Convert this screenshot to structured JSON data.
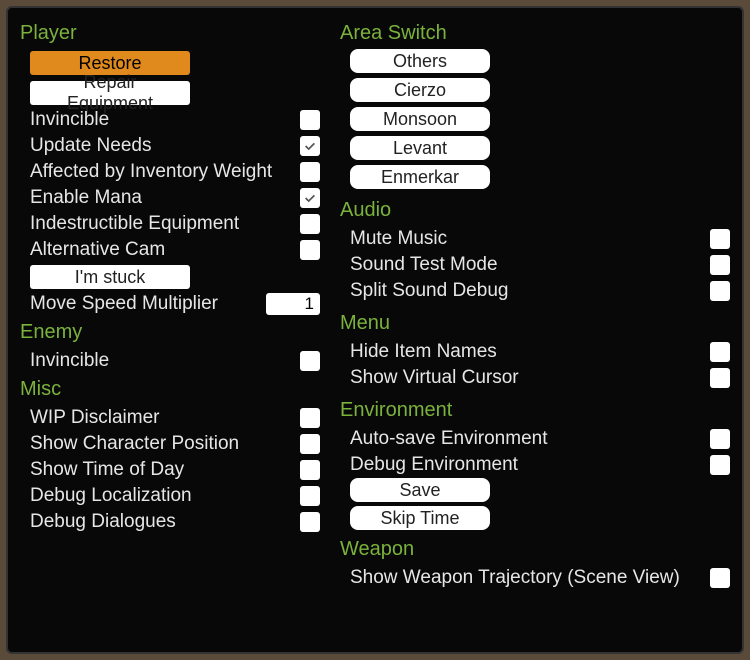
{
  "player": {
    "header": "Player",
    "restore": "Restore",
    "repair": "Repair Equipment",
    "invincible_label": "Invincible",
    "invincible": false,
    "update_needs_label": "Update Needs",
    "update_needs": true,
    "weight_label": "Affected by Inventory Weight",
    "weight": false,
    "mana_label": "Enable Mana",
    "mana": true,
    "indestructible_label": "Indestructible Equipment",
    "indestructible": false,
    "altcam_label": "Alternative Cam",
    "altcam": false,
    "stuck": "I'm stuck",
    "movespeed_label": "Move Speed Multiplier",
    "movespeed_value": "1"
  },
  "enemy": {
    "header": "Enemy",
    "invincible_label": "Invincible",
    "invincible": false
  },
  "misc": {
    "header": "Misc",
    "wip_label": "WIP Disclaimer",
    "wip": false,
    "charpos_label": "Show Character Position",
    "charpos": false,
    "tod_label": "Show Time of Day",
    "tod": false,
    "loc_label": "Debug Localization",
    "loc": false,
    "dlg_label": "Debug Dialogues",
    "dlg": false
  },
  "area": {
    "header": "Area Switch",
    "items": [
      "Others",
      "Cierzo",
      "Monsoon",
      "Levant",
      "Enmerkar"
    ]
  },
  "audio": {
    "header": "Audio",
    "mute_label": "Mute Music",
    "mute": false,
    "test_label": "Sound Test Mode",
    "test": false,
    "split_label": "Split Sound Debug",
    "split": false
  },
  "menu": {
    "header": "Menu",
    "hide_label": "Hide Item Names",
    "hide": false,
    "cursor_label": "Show Virtual Cursor",
    "cursor": false
  },
  "env": {
    "header": "Environment",
    "autosave_label": "Auto-save Environment",
    "autosave": false,
    "debug_label": "Debug Environment",
    "debug": false,
    "save": "Save",
    "skip": "Skip Time"
  },
  "weapon": {
    "header": "Weapon",
    "traj_label": "Show Weapon Trajectory (Scene View)",
    "traj": false
  }
}
